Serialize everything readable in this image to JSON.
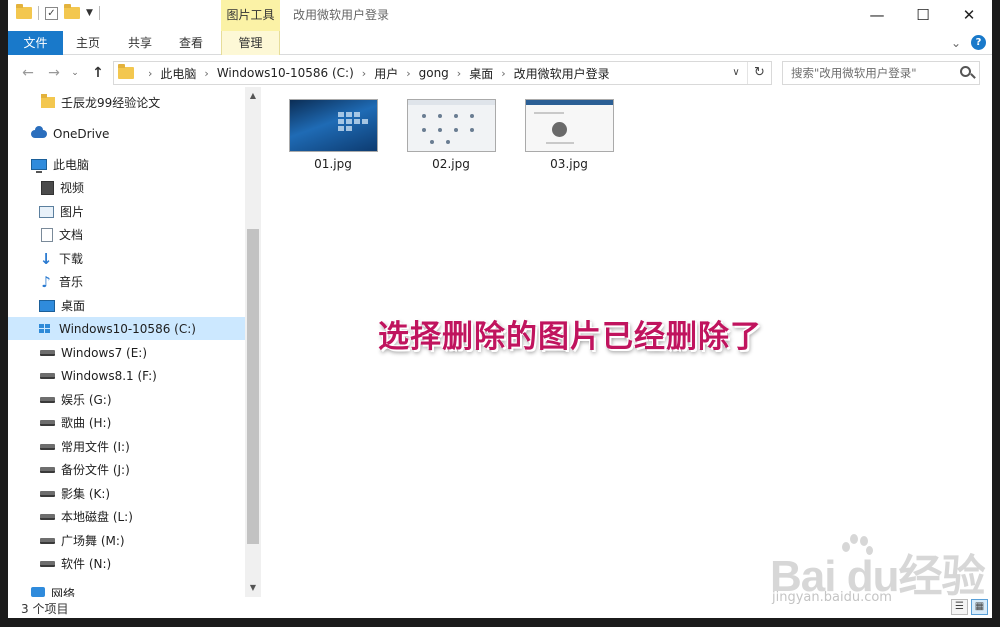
{
  "window": {
    "title": "改用微软用户登录",
    "context_group": "图片工具",
    "controls": {
      "minimize": "—",
      "maximize": "☐",
      "close": "✕"
    }
  },
  "ribbon": {
    "tabs": [
      {
        "label": "文件"
      },
      {
        "label": "主页"
      },
      {
        "label": "共享"
      },
      {
        "label": "查看"
      },
      {
        "label": "管理"
      }
    ],
    "expand_glyph": "⌄",
    "help_glyph": "?"
  },
  "address": {
    "breadcrumb": [
      "此电脑",
      "Windows10-10586 (C:)",
      "用户",
      "gong",
      "桌面",
      "改用微软用户登录"
    ],
    "separator": "›",
    "back_glyph": "←",
    "forward_glyph": "→",
    "dropdown_glyph": "⌄",
    "up_glyph": "↑",
    "addr_dropdown_glyph": "∨",
    "refresh_glyph": "↻"
  },
  "search": {
    "placeholder": "搜索\"改用微软用户登录\"",
    "icon": "search-icon"
  },
  "nav": {
    "items": [
      {
        "label": "壬辰龙99经验论文",
        "icon": "folder-icon"
      },
      {
        "label": "OneDrive",
        "icon": "onedrive-icon"
      },
      {
        "label": "此电脑",
        "icon": "computer-icon"
      },
      {
        "label": "视频",
        "icon": "video-icon"
      },
      {
        "label": "图片",
        "icon": "pictures-icon"
      },
      {
        "label": "文档",
        "icon": "documents-icon"
      },
      {
        "label": "下载",
        "icon": "download-icon"
      },
      {
        "label": "音乐",
        "icon": "music-icon"
      },
      {
        "label": "桌面",
        "icon": "desktop-icon"
      },
      {
        "label": "Windows10-10586 (C:)",
        "icon": "system-drive-icon",
        "selected": true
      },
      {
        "label": "Windows7 (E:)",
        "icon": "drive-icon"
      },
      {
        "label": "Windows8.1 (F:)",
        "icon": "drive-icon"
      },
      {
        "label": "娱乐 (G:)",
        "icon": "drive-icon"
      },
      {
        "label": "歌曲 (H:)",
        "icon": "drive-icon"
      },
      {
        "label": "常用文件 (I:)",
        "icon": "drive-icon"
      },
      {
        "label": "备份文件  (J:)",
        "icon": "drive-icon"
      },
      {
        "label": "影集 (K:)",
        "icon": "drive-icon"
      },
      {
        "label": "本地磁盘 (L:)",
        "icon": "drive-icon"
      },
      {
        "label": "广场舞 (M:)",
        "icon": "drive-icon"
      },
      {
        "label": "软件 (N:)",
        "icon": "drive-icon"
      },
      {
        "label": "网络",
        "icon": "network-icon"
      }
    ],
    "scroll_up_glyph": "▲",
    "scroll_down_glyph": "▼"
  },
  "files": [
    {
      "name": "01.jpg"
    },
    {
      "name": "02.jpg"
    },
    {
      "name": "03.jpg"
    }
  ],
  "overlay": {
    "text": "选择删除的图片已经删除了",
    "color": "#c0145e"
  },
  "watermark": {
    "brand": "Bai du经验",
    "url": "jingyan.baidu.com"
  },
  "status": {
    "count": "3 个项目",
    "view_details_glyph": "☰",
    "view_icons_glyph": "▦"
  },
  "colors": {
    "accent": "#1979ca",
    "selection": "#cce8ff",
    "context_tab": "#fbf2a6"
  }
}
